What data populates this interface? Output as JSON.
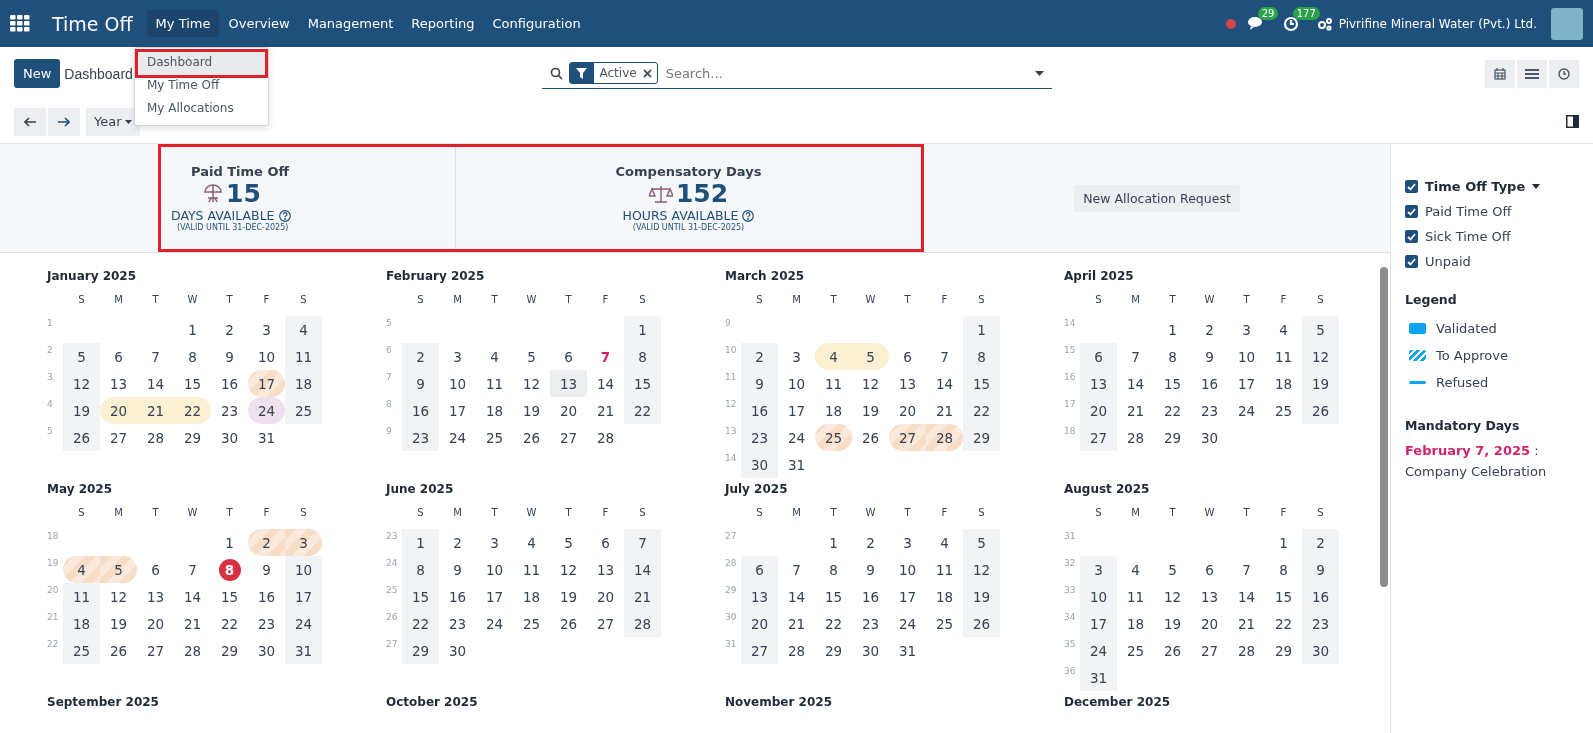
{
  "navbar": {
    "app_name": "Time Off",
    "menu": [
      {
        "label": "My Time",
        "selected": true
      },
      {
        "label": "Overview",
        "selected": false
      },
      {
        "label": "Management",
        "selected": false
      },
      {
        "label": "Reporting",
        "selected": false
      },
      {
        "label": "Configuration",
        "selected": false
      }
    ],
    "messages_count": "29",
    "activities_count": "177",
    "company": "Pivrifine Mineral Water (Pvt.) Ltd."
  },
  "dropdown": {
    "items": [
      {
        "label": "Dashboard",
        "selected": true
      },
      {
        "label": "My Time Off",
        "selected": false
      },
      {
        "label": "My Allocations",
        "selected": false
      }
    ]
  },
  "control_panel": {
    "new_button": "New",
    "breadcrumb": "Dashboard",
    "search": {
      "facet": "Active",
      "placeholder": "Search..."
    },
    "period_button": "Year"
  },
  "summary": {
    "cards": [
      {
        "kind": "paid",
        "title": "Paid Time Off",
        "amount": "15",
        "unit": "DAYS AVAILABLE",
        "validity": "(VALID UNTIL 31-DEC-2025)"
      },
      {
        "kind": "compensatory",
        "title": "Compensatory Days",
        "amount": "152",
        "unit": "HOURS AVAILABLE",
        "validity": "(VALID UNTIL 31-DEC-2025)"
      }
    ],
    "request_button": "New Allocation Request"
  },
  "months": [
    {
      "title": "January 2025",
      "weekdays": [
        "S",
        "M",
        "T",
        "W",
        "T",
        "F",
        "S"
      ],
      "weeks": [
        {
          "number": "1",
          "days": [
            "1",
            "2",
            "3",
            "4"
          ]
        },
        {
          "number": "2",
          "days": [
            "5",
            "6",
            "7",
            "8",
            "9",
            "10",
            "11"
          ]
        },
        {
          "number": "3",
          "days": [
            "12",
            "13",
            "14",
            "15",
            "16",
            {
              "day": "17",
              "kind": "to_approve"
            },
            "18"
          ]
        },
        {
          "number": "4",
          "days": [
            "19",
            {
              "day": "20",
              "kind": "validated"
            },
            {
              "day": "21",
              "kind": "validated"
            },
            {
              "day": "22",
              "kind": "validated"
            },
            "23",
            {
              "day": "24",
              "kind": "other"
            },
            "25"
          ]
        },
        {
          "number": "5",
          "days": [
            "26",
            "27",
            "28",
            "29",
            "30",
            "31"
          ]
        }
      ]
    },
    {
      "title": "February 2025",
      "weekdays": [
        "S",
        "M",
        "T",
        "W",
        "T",
        "F",
        "S"
      ],
      "weeks": [
        {
          "number": "5",
          "days": [
            "1"
          ]
        },
        {
          "number": "6",
          "days": [
            "2",
            "3",
            "4",
            "5",
            "6",
            {
              "day": "7",
              "kind": "mandatory"
            },
            "8"
          ]
        },
        {
          "number": "7",
          "days": [
            "9",
            "10",
            "11",
            "12",
            {
              "day": "13",
              "kind": "holiday"
            },
            "14",
            "15"
          ]
        },
        {
          "number": "8",
          "days": [
            "16",
            "17",
            "18",
            "19",
            "20",
            "21",
            "22"
          ]
        },
        {
          "number": "9",
          "days": [
            "23",
            "24",
            "25",
            "26",
            "27",
            "28"
          ]
        }
      ]
    },
    {
      "title": "March 2025",
      "weekdays": [
        "S",
        "M",
        "T",
        "W",
        "T",
        "F",
        "S"
      ],
      "weeks": [
        {
          "number": "9",
          "days": [
            "1"
          ]
        },
        {
          "number": "10",
          "days": [
            "2",
            "3",
            {
              "day": "4",
              "kind": "validated"
            },
            {
              "day": "5",
              "kind": "validated"
            },
            "6",
            "7",
            "8"
          ]
        },
        {
          "number": "11",
          "days": [
            "9",
            "10",
            "11",
            "12",
            "13",
            "14",
            "15"
          ]
        },
        {
          "number": "12",
          "days": [
            "16",
            "17",
            "18",
            "19",
            "20",
            "21",
            "22"
          ]
        },
        {
          "number": "13",
          "days": [
            "23",
            "24",
            {
              "day": "25",
              "kind": "to_approve"
            },
            "26",
            {
              "day": "27",
              "kind": "to_approve"
            },
            {
              "day": "28",
              "kind": "to_approve"
            },
            "29"
          ]
        },
        {
          "number": "14",
          "days": [
            "30",
            "31"
          ]
        }
      ]
    },
    {
      "title": "April 2025",
      "weekdays": [
        "S",
        "M",
        "T",
        "W",
        "T",
        "F",
        "S"
      ],
      "weeks": [
        {
          "number": "14",
          "days": [
            "1",
            "2",
            "3",
            "4",
            "5"
          ]
        },
        {
          "number": "15",
          "days": [
            "6",
            "7",
            "8",
            "9",
            "10",
            "11",
            "12"
          ]
        },
        {
          "number": "16",
          "days": [
            "13",
            "14",
            "15",
            "16",
            "17",
            "18",
            "19"
          ]
        },
        {
          "number": "17",
          "days": [
            "20",
            "21",
            "22",
            "23",
            "24",
            "25",
            "26"
          ]
        },
        {
          "number": "18",
          "days": [
            "27",
            "28",
            "29",
            "30"
          ]
        }
      ]
    },
    {
      "title": "May 2025",
      "weekdays": [
        "S",
        "M",
        "T",
        "W",
        "T",
        "F",
        "S"
      ],
      "weeks": [
        {
          "number": "18",
          "days": [
            "1",
            {
              "day": "2",
              "kind": "to_approve"
            },
            {
              "day": "3",
              "kind": "to_approve"
            }
          ]
        },
        {
          "number": "19",
          "days": [
            {
              "day": "4",
              "kind": "to_approve"
            },
            {
              "day": "5",
              "kind": "to_approve"
            },
            "6",
            "7",
            {
              "day": "8",
              "kind": "today"
            },
            "9",
            "10"
          ]
        },
        {
          "number": "20",
          "days": [
            "11",
            "12",
            "13",
            "14",
            "15",
            "16",
            "17"
          ]
        },
        {
          "number": "21",
          "days": [
            "18",
            "19",
            "20",
            "21",
            "22",
            "23",
            "24"
          ]
        },
        {
          "number": "22",
          "days": [
            "25",
            "26",
            "27",
            "28",
            "29",
            "30",
            "31"
          ]
        }
      ]
    },
    {
      "title": "June 2025",
      "weekdays": [
        "S",
        "M",
        "T",
        "W",
        "T",
        "F",
        "S"
      ],
      "weeks": [
        {
          "number": "23",
          "days": [
            "1",
            "2",
            "3",
            "4",
            "5",
            "6",
            "7"
          ]
        },
        {
          "number": "24",
          "days": [
            "8",
            "9",
            "10",
            "11",
            "12",
            "13",
            "14"
          ]
        },
        {
          "number": "25",
          "days": [
            "15",
            "16",
            "17",
            "18",
            "19",
            "20",
            "21"
          ]
        },
        {
          "number": "26",
          "days": [
            "22",
            "23",
            "24",
            "25",
            "26",
            "27",
            "28"
          ]
        },
        {
          "number": "27",
          "days": [
            "29",
            "30"
          ]
        }
      ]
    },
    {
      "title": "July 2025",
      "weekdays": [
        "S",
        "M",
        "T",
        "W",
        "T",
        "F",
        "S"
      ],
      "weeks": [
        {
          "number": "27",
          "days": [
            "1",
            "2",
            "3",
            "4",
            "5"
          ]
        },
        {
          "number": "28",
          "days": [
            "6",
            "7",
            "8",
            "9",
            "10",
            "11",
            "12"
          ]
        },
        {
          "number": "29",
          "days": [
            "13",
            "14",
            "15",
            "16",
            "17",
            "18",
            "19"
          ]
        },
        {
          "number": "30",
          "days": [
            "20",
            "21",
            "22",
            "23",
            "24",
            "25",
            "26"
          ]
        },
        {
          "number": "31",
          "days": [
            "27",
            "28",
            "29",
            "30",
            "31"
          ]
        }
      ]
    },
    {
      "title": "August 2025",
      "weekdays": [
        "S",
        "M",
        "T",
        "W",
        "T",
        "F",
        "S"
      ],
      "weeks": [
        {
          "number": "31",
          "days": [
            "1",
            "2"
          ]
        },
        {
          "number": "32",
          "days": [
            "3",
            "4",
            "5",
            "6",
            "7",
            "8",
            "9"
          ]
        },
        {
          "number": "33",
          "days": [
            "10",
            "11",
            "12",
            "13",
            "14",
            "15",
            "16"
          ]
        },
        {
          "number": "34",
          "days": [
            "17",
            "18",
            "19",
            "20",
            "21",
            "22",
            "23"
          ]
        },
        {
          "number": "35",
          "days": [
            "24",
            "25",
            "26",
            "27",
            "28",
            "29",
            "30"
          ]
        },
        {
          "number": "36",
          "days": [
            "31"
          ]
        }
      ]
    },
    {
      "title": "September 2025"
    },
    {
      "title": "October 2025"
    },
    {
      "title": "November 2025"
    },
    {
      "title": "December 2025"
    }
  ],
  "sidebar": {
    "filters": [
      {
        "label": "Time Off Type",
        "checked": true,
        "kind": "group"
      },
      {
        "label": "Paid Time Off",
        "checked": true,
        "kind": "item"
      },
      {
        "label": "Sick Time Off",
        "checked": true,
        "kind": "item"
      },
      {
        "label": "Unpaid",
        "checked": true,
        "kind": "item"
      }
    ],
    "legend_title": "Legend",
    "legend": [
      {
        "label": "Validated",
        "kind": "validated"
      },
      {
        "label": "To Approve",
        "kind": "to_approve"
      },
      {
        "label": "Refused",
        "kind": "refused"
      }
    ],
    "mandatory_title": "Mandatory Days",
    "mandatory_days": [
      {
        "date": "February 7, 2025",
        "separator": ":",
        "name": "Company Celebration"
      }
    ]
  }
}
